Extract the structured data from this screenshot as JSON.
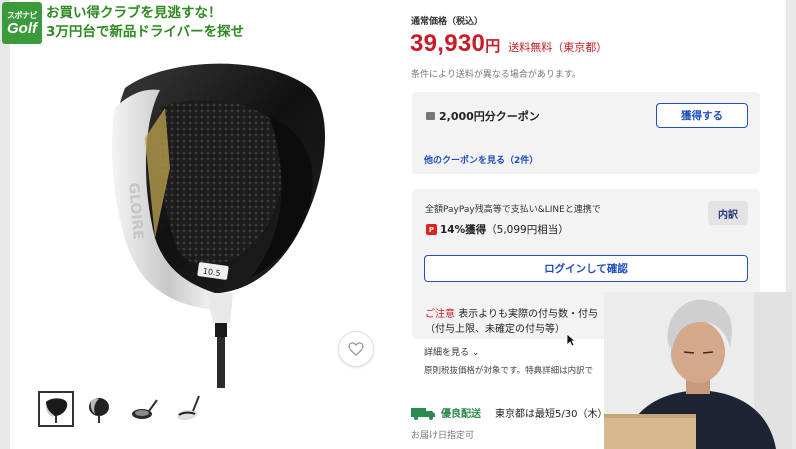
{
  "channel": {
    "logo_top": "スポナビ",
    "logo_main": "Golf",
    "headline_line1": "お買い得クラブを見逃すな！",
    "headline_line2": "3万円台で新品ドライバーを探せ"
  },
  "product": {
    "club_brand_text": "GLOIRE",
    "loft_text": "10.5",
    "thumbnails": [
      "thumb-1",
      "thumb-2",
      "thumb-3",
      "thumb-4"
    ],
    "active_thumbnail": 0
  },
  "price": {
    "label": "通常価格（税込）",
    "amount": "39,930",
    "yen": "円",
    "shipping": "送料無料（東京都）",
    "condition_note": "条件により送料が異なる場合があります。"
  },
  "coupon": {
    "text": "2,000円分クーポン",
    "acquire_button": "獲得する",
    "other_link": "他のクーポンを見る（2件）"
  },
  "points": {
    "description": "全額PayPay残高等で支払い&LINEと連携で",
    "detail_button": "内訳",
    "p_icon": "P",
    "earn_rate": "14%獲得",
    "earn_amount": "（5,099円相当）",
    "login_button": "ログインして確認",
    "caution_label": "ご注意",
    "caution_text": "表示よりも実際の付与数・付与",
    "caution_text2": "（付与上限、未確定の付与等）"
  },
  "details_link": "詳細を見る ⌄",
  "tax_note": "原則税抜価格が対象です。特典詳細は内訳で",
  "delivery": {
    "label": "優良配送",
    "date_text": "東京都は最短5/30（木）",
    "date_spec": "お届け日指定可"
  },
  "colors": {
    "price_red": "#c81b25",
    "link_blue": "#1f4fbf",
    "panel_gray": "#f3f3f3",
    "channel_green": "#2d8a1f"
  }
}
